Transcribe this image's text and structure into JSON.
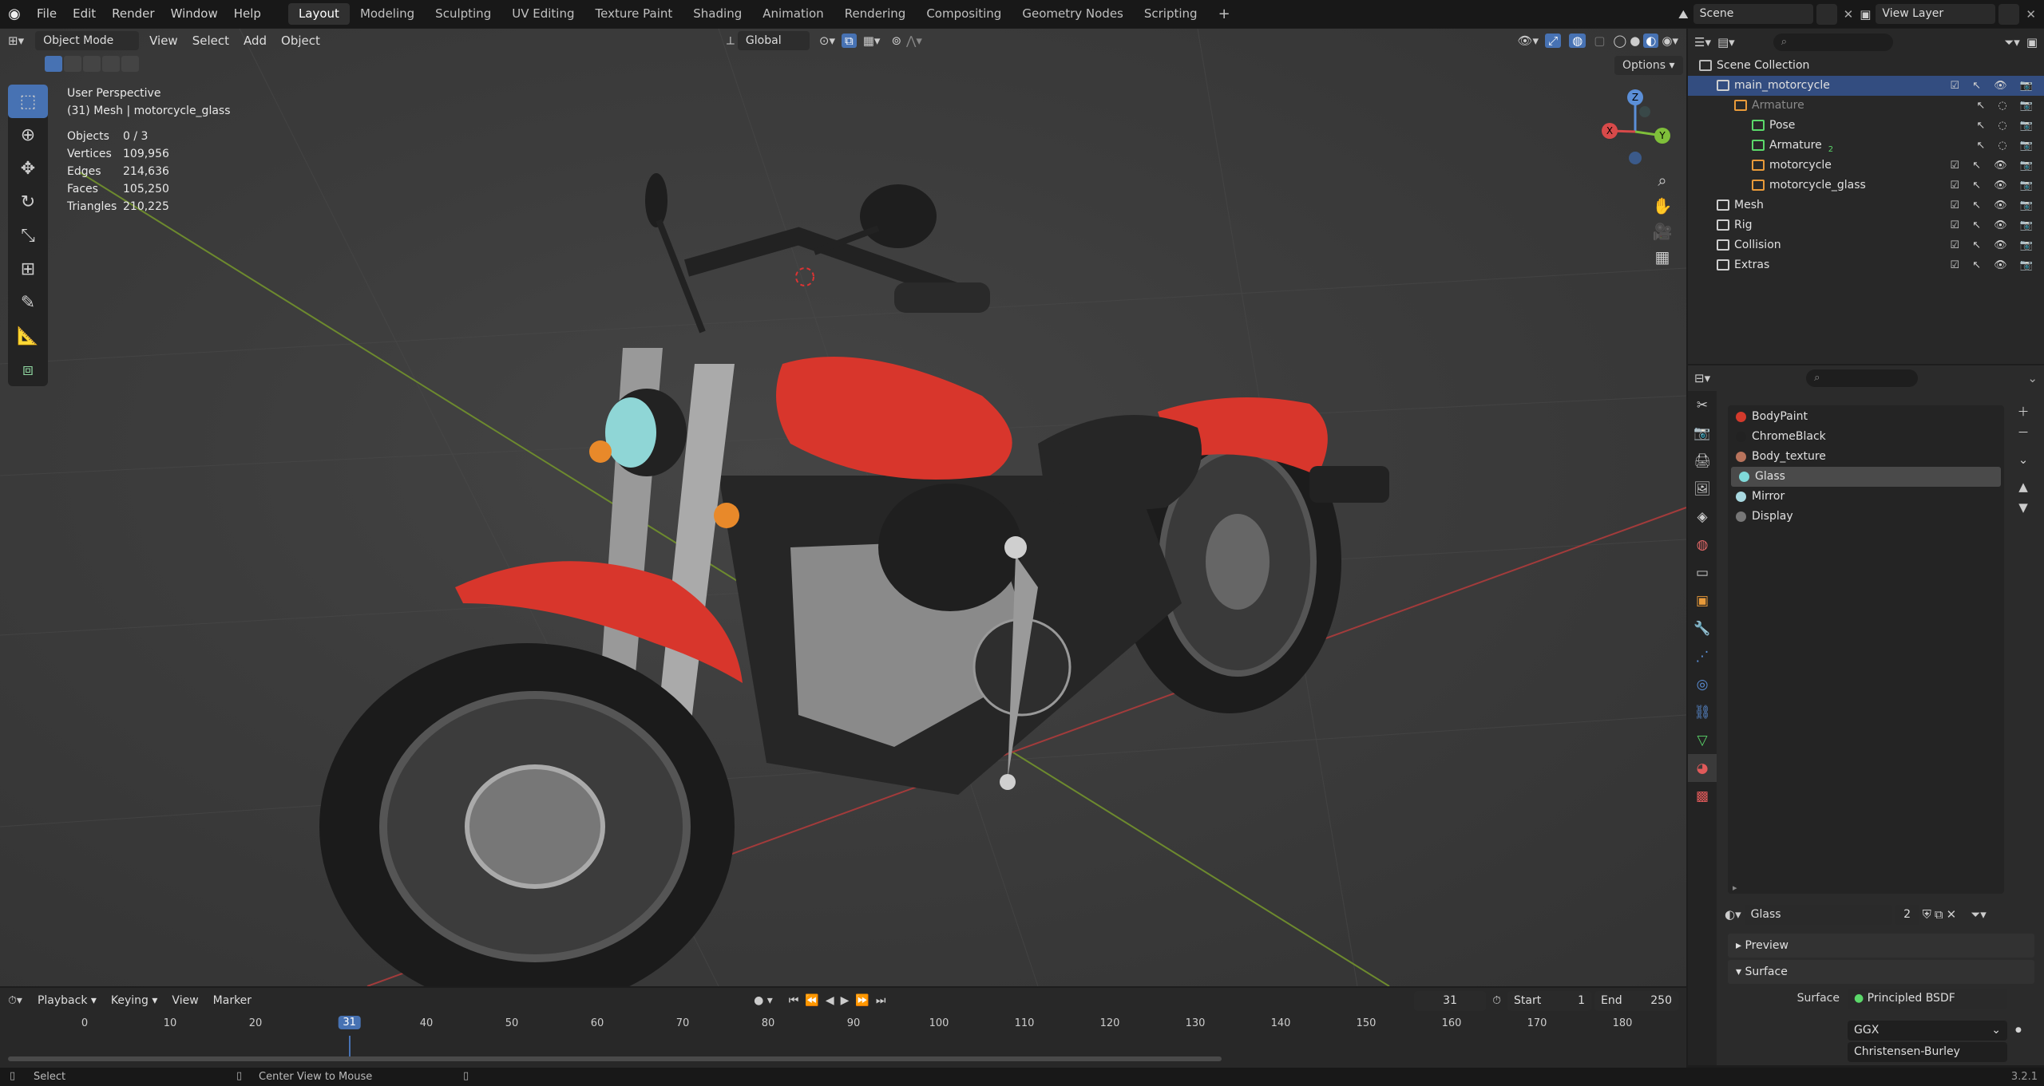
{
  "topbar": {
    "menus": [
      "File",
      "Edit",
      "Render",
      "Window",
      "Help"
    ],
    "workspaces": [
      "Layout",
      "Modeling",
      "Sculpting",
      "UV Editing",
      "Texture Paint",
      "Shading",
      "Animation",
      "Rendering",
      "Compositing",
      "Geometry Nodes",
      "Scripting"
    ],
    "active_workspace": "Layout",
    "add_workspace": "+",
    "scene": "Scene",
    "view_layer": "View Layer"
  },
  "viewport": {
    "mode": "Object Mode",
    "menus": [
      "View",
      "Select",
      "Add",
      "Object"
    ],
    "transform_orientation": "Global",
    "options_label": "Options",
    "perspective": "User Perspective",
    "active_object": "(31) Mesh | motorcycle_glass",
    "stats": [
      {
        "label": "Objects",
        "value": "0 / 3"
      },
      {
        "label": "Vertices",
        "value": "109,956"
      },
      {
        "label": "Edges",
        "value": "214,636"
      },
      {
        "label": "Faces",
        "value": "105,250"
      },
      {
        "label": "Triangles",
        "value": "210,225"
      }
    ],
    "gizmo": {
      "x": "X",
      "y": "Y",
      "z": "Z"
    }
  },
  "outliner": {
    "root": "Scene Collection",
    "rows": [
      {
        "label": "main_motorcycle",
        "indent": 1,
        "selected": true,
        "icon": "collection",
        "vis": true
      },
      {
        "label": "Armature",
        "indent": 2,
        "dim": true,
        "icon": "armature",
        "vis": false
      },
      {
        "label": "Pose",
        "indent": 3,
        "icon": "pose",
        "vis": false
      },
      {
        "label": "Armature",
        "indent": 3,
        "icon": "armature-data",
        "vis": false,
        "badge": "2"
      },
      {
        "label": "motorcycle",
        "indent": 3,
        "icon": "mesh",
        "vis": true
      },
      {
        "label": "motorcycle_glass",
        "indent": 3,
        "icon": "mesh",
        "vis": true
      },
      {
        "label": "Mesh",
        "indent": 1,
        "icon": "collection",
        "vis": true
      },
      {
        "label": "Rig",
        "indent": 1,
        "icon": "collection",
        "vis": true
      },
      {
        "label": "Collision",
        "indent": 1,
        "icon": "collection",
        "vis": true
      },
      {
        "label": "Extras",
        "indent": 1,
        "icon": "collection",
        "vis": true
      }
    ]
  },
  "properties": {
    "materials": [
      {
        "name": "BodyPaint",
        "color": "#d33a2c"
      },
      {
        "name": "ChromeBlack",
        "color": "#222222"
      },
      {
        "name": "Body_texture",
        "color": "#b8735c"
      },
      {
        "name": "Glass",
        "color": "#7fd8d8",
        "selected": true
      },
      {
        "name": "Mirror",
        "color": "#a8d8e0"
      },
      {
        "name": "Display",
        "color": "#777777"
      }
    ],
    "material_name": "Glass",
    "user_count": "2",
    "panels": {
      "preview": "Preview",
      "surface": "Surface"
    },
    "surface_label": "Surface",
    "surface_value": "Principled BSDF",
    "distribution": "GGX",
    "subsurface": "Christensen-Burley"
  },
  "timeline": {
    "menus": [
      "Playback",
      "Keying",
      "View",
      "Marker"
    ],
    "current_frame": "31",
    "start_label": "Start",
    "start": "1",
    "end_label": "End",
    "end": "250",
    "ticks": [
      "0",
      "10",
      "20",
      "31",
      "40",
      "50",
      "60",
      "70",
      "80",
      "90",
      "100",
      "110",
      "120",
      "130",
      "140",
      "150",
      "160",
      "170",
      "180"
    ]
  },
  "statusbar": {
    "select": "Select",
    "center": "Center View to Mouse",
    "version": "3.2.1"
  },
  "colors": {
    "accent": "#4772b3",
    "selection": "#334d80",
    "body_red": "#d8362c"
  }
}
